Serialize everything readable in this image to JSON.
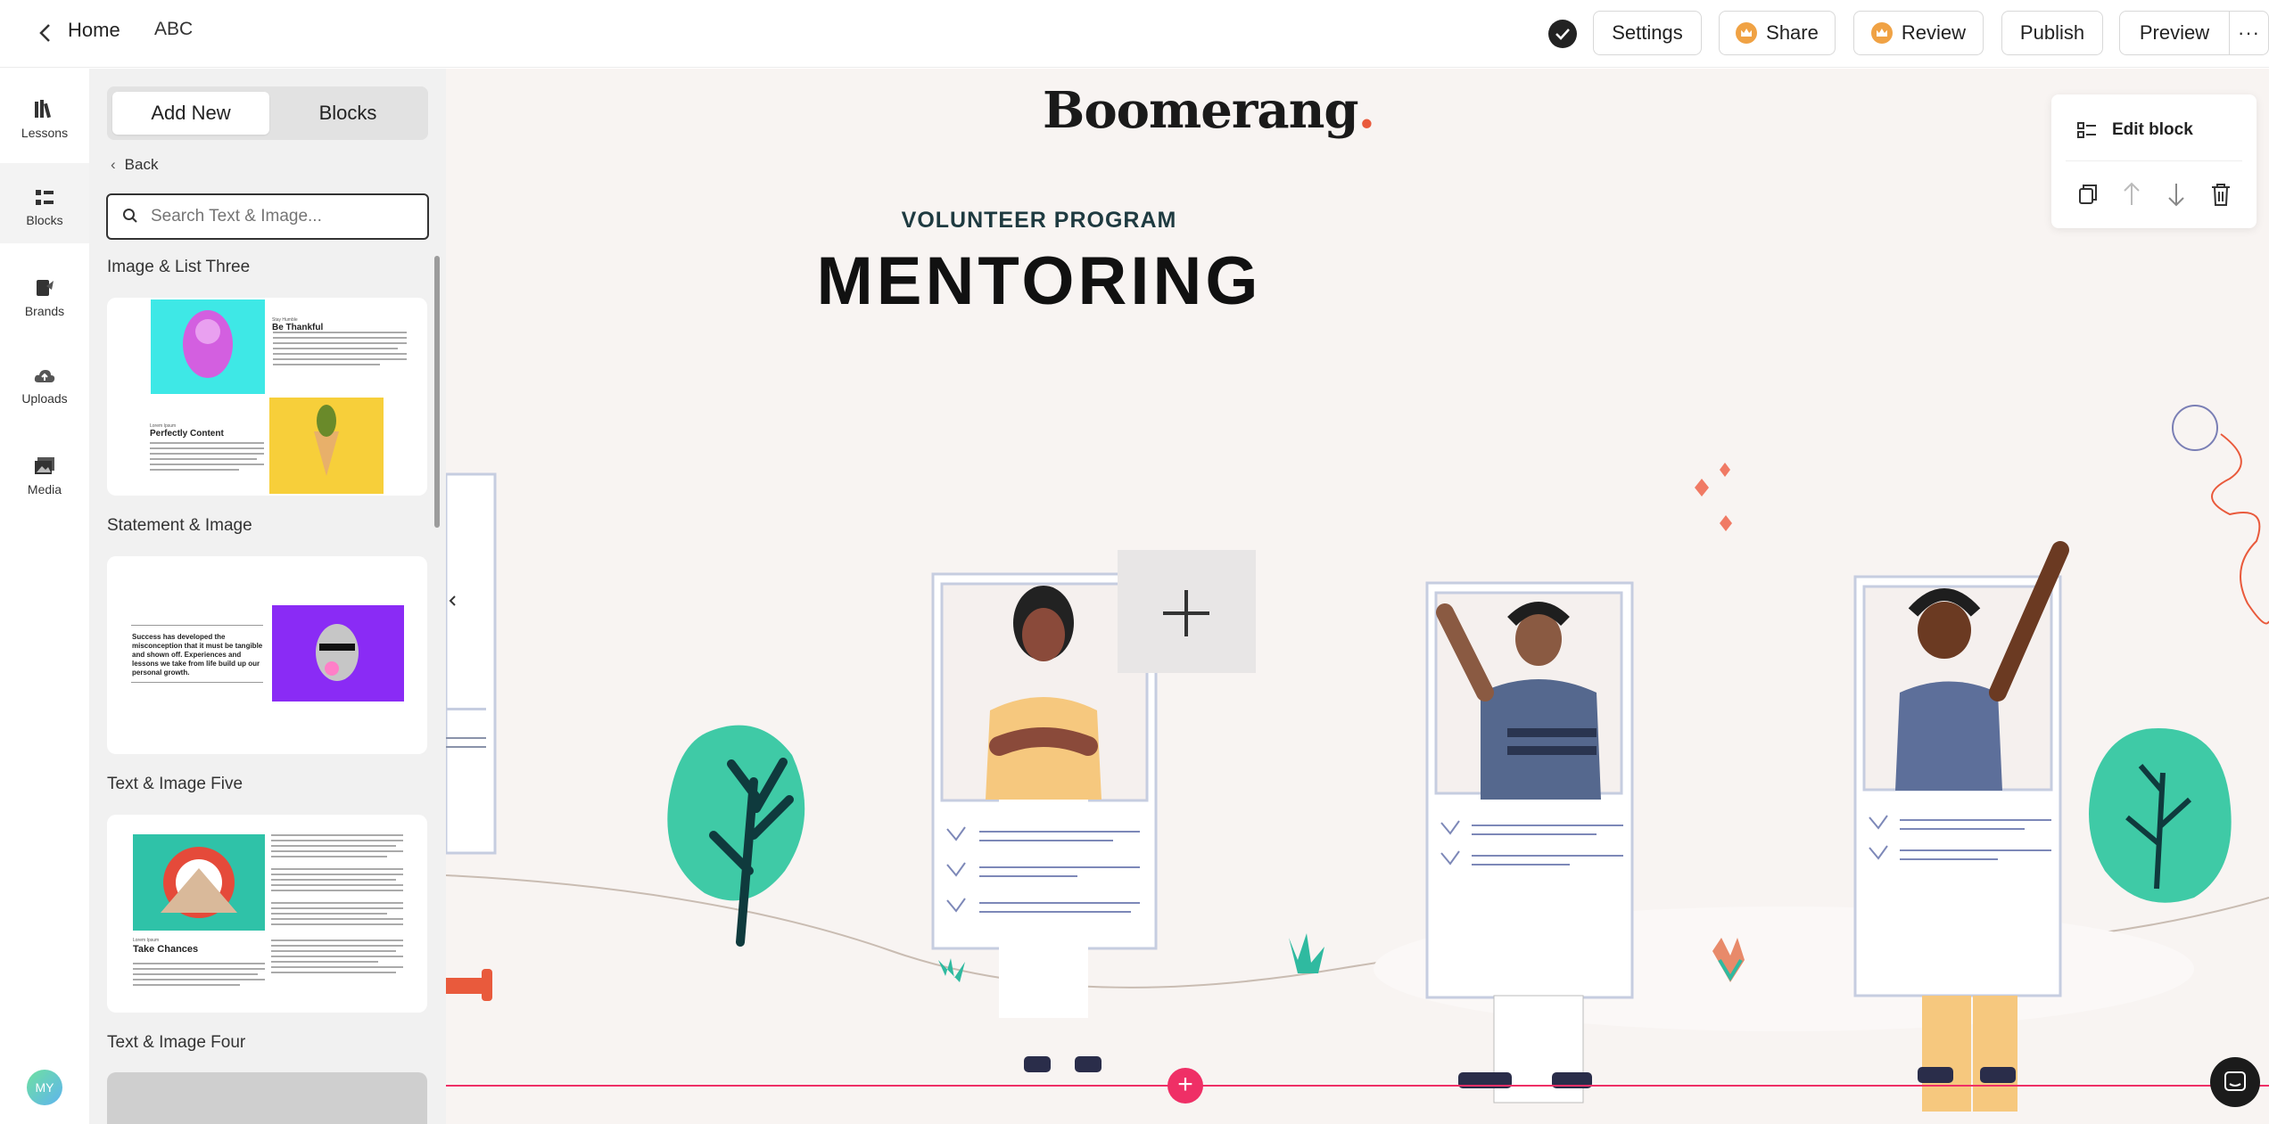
{
  "topbar": {
    "home_label": "Home",
    "project_name": "ABC",
    "buttons": {
      "settings": "Settings",
      "share": "Share",
      "review": "Review",
      "publish": "Publish",
      "preview": "Preview"
    },
    "more_icon": "ellipsis-icon"
  },
  "rail": {
    "items": [
      {
        "label": "Lessons",
        "icon": "books-icon"
      },
      {
        "label": "Blocks",
        "icon": "blocks-icon"
      },
      {
        "label": "Brands",
        "icon": "brush-icon"
      },
      {
        "label": "Uploads",
        "icon": "cloud-upload-icon"
      },
      {
        "label": "Media",
        "icon": "image-stack-icon"
      }
    ],
    "avatar_initials": "MY"
  },
  "panel": {
    "tabs": {
      "add_new": "Add New",
      "blocks": "Blocks"
    },
    "back_label": "Back",
    "search_placeholder": "Search Text & Image...",
    "sections": [
      {
        "title": "Image & List Three",
        "preview": {
          "top_small": "Stay Humble",
          "top_heading": "Be Thankful",
          "bottom_small": "Lorem Ipsum",
          "bottom_heading": "Perfectly Content"
        }
      },
      {
        "title": "Statement & Image",
        "preview": {
          "statement": "Success has developed the misconception that it must be tangible and shown off. Experiences and lessons we take from life build up our personal growth."
        }
      },
      {
        "title": "Text & Image Five",
        "preview": {
          "small": "Lorem Ipsum",
          "heading": "Take Chances"
        }
      },
      {
        "title": "Text & Image Four"
      }
    ]
  },
  "canvas": {
    "logo": "Boomerang",
    "logo_dot": ".",
    "eyebrow": "VOLUNTEER PROGRAM",
    "headline": "MENTORING",
    "edit_popover": {
      "edit_label": "Edit block",
      "icons": [
        "copy-icon",
        "arrow-up-icon",
        "arrow-down-icon",
        "trash-icon"
      ]
    },
    "add_block_symbol": "+"
  },
  "colors": {
    "accent_pink": "#ef2f66",
    "canvas_bg": "#f8f4f2",
    "crown_orange": "#f0a244",
    "logo_dot": "#e95a3c"
  }
}
